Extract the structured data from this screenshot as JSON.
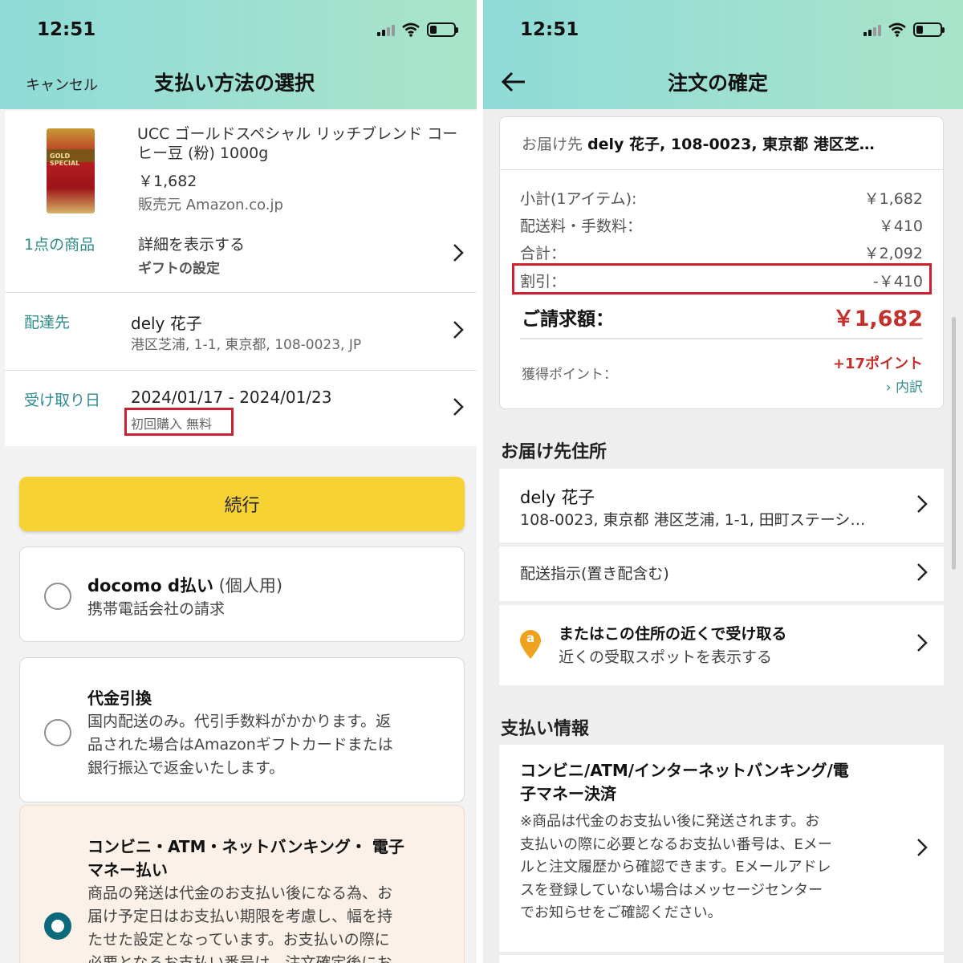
{
  "status_bar": {
    "time": "12:51"
  },
  "left": {
    "header": {
      "cancel": "キャンセル",
      "title": "支払い方法の選択"
    },
    "product": {
      "name_line1": "UCC ゴールドスペシャル リッチブレンド コー",
      "name_line2": "ヒー豆 (粉) 1000g",
      "price": "￥1,682",
      "seller": "販売元 Amazon.co.jp",
      "image_text": "GOLD SPECIAL"
    },
    "items": {
      "label": "1点の商品",
      "detail": "詳細を表示する",
      "gift": "ギフトの設定"
    },
    "delivery_to": {
      "label": "配達先",
      "name": "dely 花子",
      "address": "港区芝浦, 1-1, 東京都, 108-0023, JP"
    },
    "receive_date": {
      "label": "受け取り日",
      "range": "2024/01/17 - 2024/01/23",
      "note": "初回購入 無料"
    },
    "continue_label": "続行",
    "payment_options": [
      {
        "title_bold": "docomo d払い",
        "title_suffix": " (個人用)",
        "desc": "携帯電話会社の請求",
        "selected": false
      },
      {
        "title": "代金引換",
        "desc_lines": [
          "国内配送のみ。代引手数料がかかります。返",
          "品された場合はAmazonギフトカードまたは",
          "銀行振込で返金いたします。"
        ],
        "selected": false
      },
      {
        "title_lines": [
          "コンビニ・ATM・ネットバンキング・ 電子",
          "マネー払い"
        ],
        "desc_lines": [
          "商品の発送は代金のお支払い後になる為、お",
          "届け予定日はお支払い期限を考慮し、幅を持",
          "たせた設定となっています。お支払いの際に",
          "必要となるお支払い番号は、注文確定後にお"
        ],
        "selected": true
      }
    ]
  },
  "right": {
    "header": {
      "title": "注文の確定"
    },
    "ship_to": {
      "prefix": "お届け先",
      "value": "dely 花子, 108-0023, 東京都 港区芝…"
    },
    "summary": {
      "subtotal_label": "小計(1アイテム):",
      "subtotal": "￥1,682",
      "shipping_label": "配送料・手数料：",
      "shipping": "￥410",
      "total_label": "合計：",
      "total": "￥2,092",
      "discount_label": "割引：",
      "discount": "-￥410",
      "billing_label": "ご請求額：",
      "billing": "￥1,682",
      "points_label": "獲得ポイント：",
      "points": "+17ポイント",
      "breakdown": "内訳"
    },
    "address_section": {
      "title": "お届け先住所",
      "name": "dely 花子",
      "address": "108-0023, 東京都 港区芝浦, 1-1, 田町ステーシ…",
      "instructions": "配送指示(置き配含む)",
      "pickup_title": "またはこの住所の近くで受け取る",
      "pickup_desc": "近くの受取スポットを表示する",
      "pickup_icon_letter": "a"
    },
    "payment_section": {
      "title": "支払い情報",
      "method_lines": [
        "コンビニ/ATM/インターネットバンキング/電",
        "子マネー決済"
      ],
      "note_lines": [
        "※商品は代金のお支払い後に発送されます。お",
        "支払いの際に必要となるお支払い番号は、Eメー",
        "ルと注文履歴から確認できます。Eメールアドレ",
        "スを登録していない場合はメッセージセンター",
        "でお知らせをご確認ください。"
      ]
    }
  },
  "colors": {
    "accent_yellow": "#f6d233",
    "teal": "#2f8c8c",
    "price_red": "#c4302b",
    "highlight_red": "#d01f2e",
    "radio_selected": "#0a6a7a"
  }
}
